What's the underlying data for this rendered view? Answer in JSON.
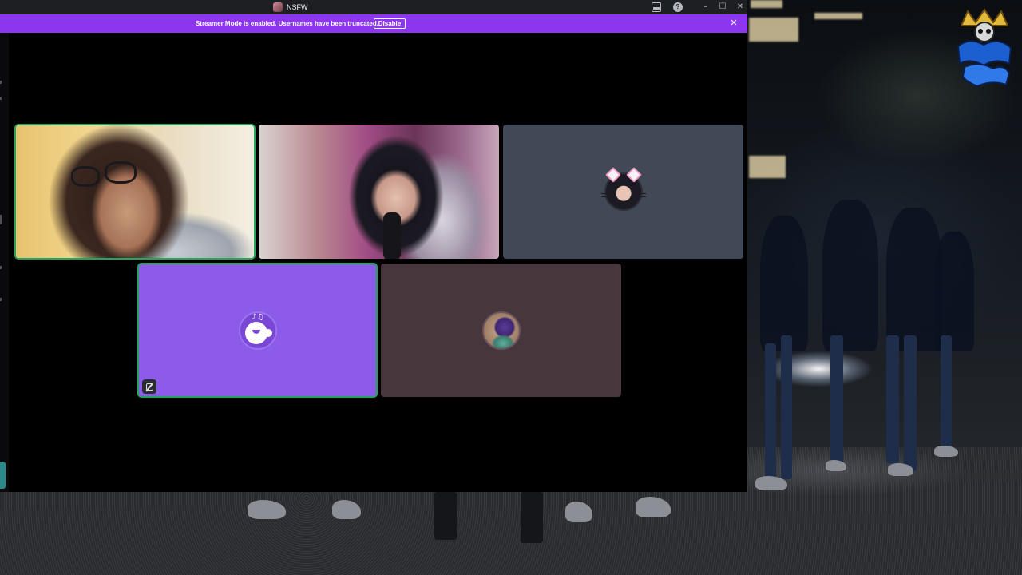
{
  "window": {
    "title": "NSFW",
    "controls": {
      "minimize": "–",
      "maximize": "☐",
      "close": "✕"
    },
    "icons": [
      "inbox-icon",
      "help-icon",
      "server-icon"
    ]
  },
  "streamer_notice": {
    "text": "Streamer Mode is enabled. Usernames have been truncated.",
    "button_label": "Disable",
    "close_glyph": "✕",
    "color": "#8c36f0"
  },
  "call": {
    "tiles": [
      {
        "kind": "camera",
        "speaking": true,
        "icon": "camera-feed"
      },
      {
        "kind": "camera",
        "speaking": false,
        "icon": "camera-feed"
      },
      {
        "kind": "avatar",
        "speaking": false,
        "icon": "cat-ear-avatar",
        "color": "#414956"
      },
      {
        "kind": "avatar",
        "speaking": true,
        "icon": "music-bot-avatar",
        "color": "#8d5bea",
        "badge_icon": "activity-icon"
      },
      {
        "kind": "avatar",
        "speaking": false,
        "icon": "creature-avatar",
        "color": "#47373d"
      }
    ],
    "speaking_color": "#23a55a"
  },
  "bot_avatar": {
    "notes": "♪♫"
  },
  "help_glyph": "?"
}
